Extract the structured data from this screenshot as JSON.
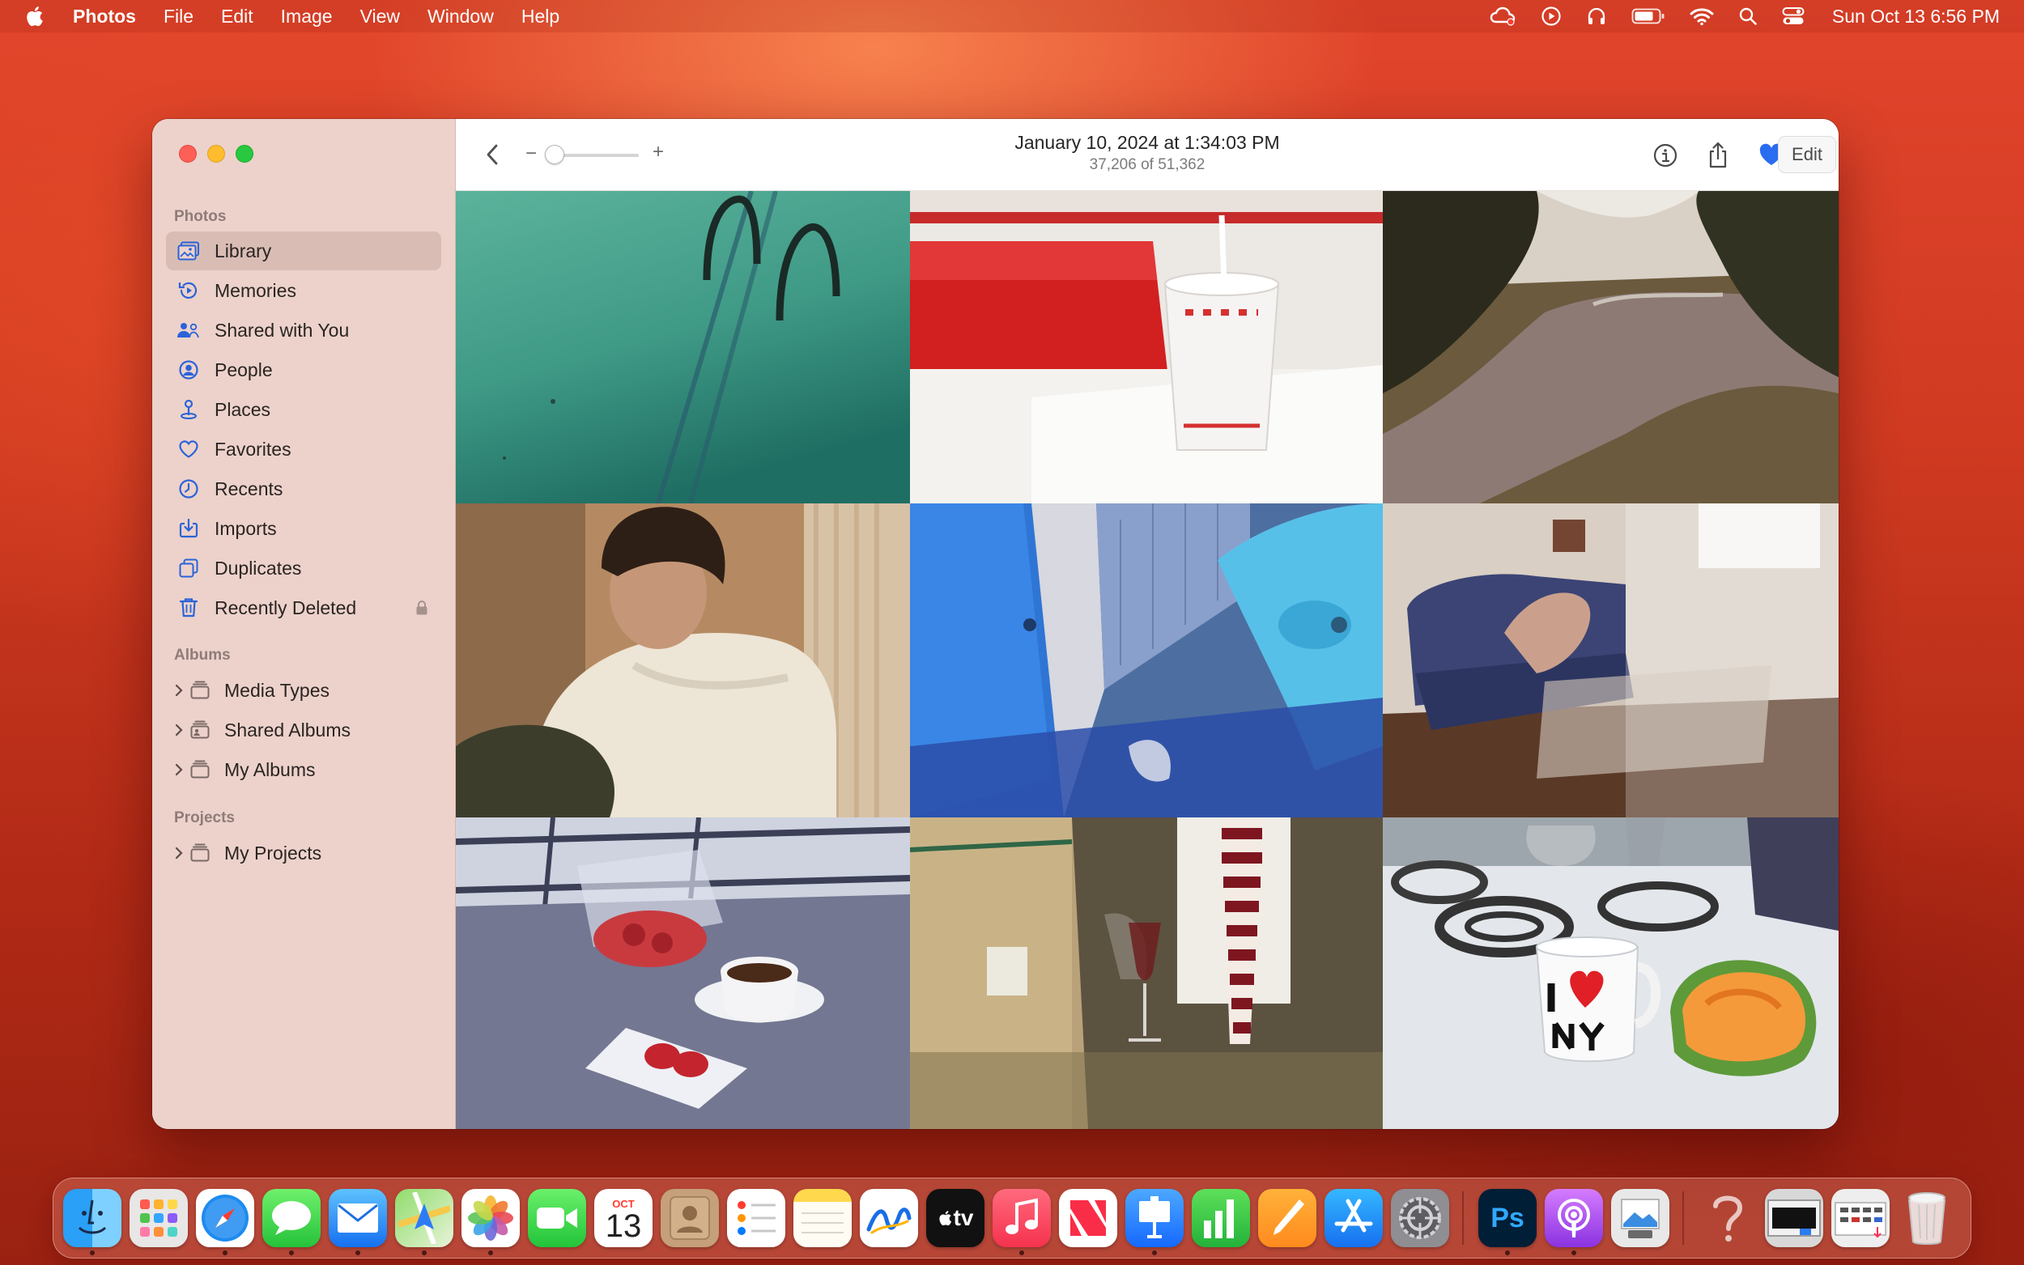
{
  "menubar": {
    "app_name": "Photos",
    "menus": [
      "File",
      "Edit",
      "Image",
      "View",
      "Window",
      "Help"
    ],
    "clock": "Sun Oct 13  6:56 PM"
  },
  "sidebar": {
    "sections": {
      "photos": "Photos",
      "albums": "Albums",
      "projects": "Projects"
    },
    "photo_items": [
      {
        "label": "Library",
        "icon": "library-icon",
        "selected": true
      },
      {
        "label": "Memories",
        "icon": "memories-icon"
      },
      {
        "label": "Shared with You",
        "icon": "shared-with-you-icon"
      },
      {
        "label": "People",
        "icon": "people-icon"
      },
      {
        "label": "Places",
        "icon": "places-icon"
      },
      {
        "label": "Favorites",
        "icon": "heart-icon"
      },
      {
        "label": "Recents",
        "icon": "clock-icon"
      },
      {
        "label": "Imports",
        "icon": "import-icon"
      },
      {
        "label": "Duplicates",
        "icon": "duplicates-icon"
      },
      {
        "label": "Recently Deleted",
        "icon": "trash-icon",
        "locked": true
      }
    ],
    "album_items": [
      {
        "label": "Media Types"
      },
      {
        "label": "Shared Albums"
      },
      {
        "label": "My Albums"
      }
    ],
    "project_items": [
      {
        "label": "My Projects"
      }
    ]
  },
  "toolbar": {
    "title": "January 10, 2024 at 1:34:03 PM",
    "subtitle": "37,206 of 51,362",
    "zoom_minus": "−",
    "zoom_plus": "+",
    "edit_label": "Edit",
    "favorite_color": "#2a6cf0"
  },
  "dock": {
    "calendar_month": "OCT",
    "calendar_day": "13",
    "tv_label": "tv",
    "photoshop_label": "Ps"
  }
}
